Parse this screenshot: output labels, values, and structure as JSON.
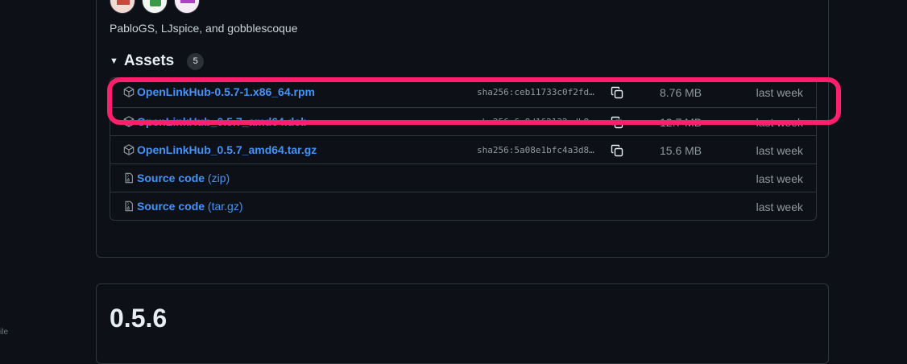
{
  "release": {
    "contributors_text": "PabloGS, LJspice, and gobblescoque",
    "assets_title": "Assets",
    "assets_count": "5"
  },
  "assets": [
    {
      "name": "OpenLinkHub-0.5.7-1.x86_64.rpm",
      "ext": "",
      "sha": "sha256:ceb11733c0f2fd…",
      "size": "8.76 MB",
      "date": "last week",
      "icon": "package-icon"
    },
    {
      "name": "OpenLinkHub_0.5.7_amd64.deb",
      "ext": "",
      "sha": "sha256:6c8d162132cdb8…",
      "size": "12.7 MB",
      "date": "last week",
      "icon": "package-icon"
    },
    {
      "name": "OpenLinkHub_0.5.7_amd64.tar.gz",
      "ext": "",
      "sha": "sha256:5a08e1bfc4a3d8…",
      "size": "15.6 MB",
      "date": "last week",
      "icon": "package-icon"
    },
    {
      "name": "Source code",
      "ext": "(zip)",
      "sha": "",
      "size": "",
      "date": "last week",
      "icon": "file-zip-icon"
    },
    {
      "name": "Source code",
      "ext": "(tar.gz)",
      "sha": "",
      "size": "",
      "date": "last week",
      "icon": "file-zip-icon"
    }
  ],
  "next_release": {
    "title": "0.5.6"
  },
  "edge_text": "ile"
}
